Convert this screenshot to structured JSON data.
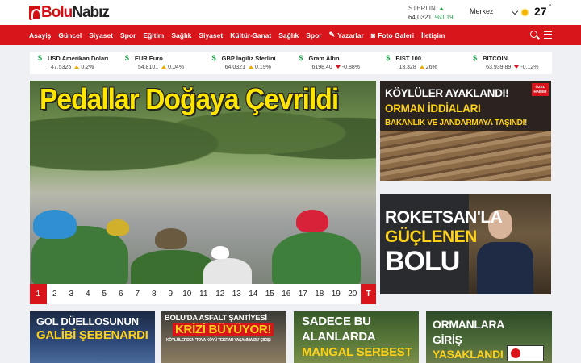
{
  "header": {
    "logo": {
      "part1": "Bolu",
      "part2": "Nabız"
    },
    "currency": {
      "label": "STERLIN",
      "value": "64,0321",
      "change": "%0.19"
    },
    "weather": {
      "city": "Merkez",
      "temperature": "27",
      "unit": "°",
      "icon": "sun-icon"
    }
  },
  "nav": {
    "items": [
      "Asayiş",
      "Güncel",
      "Siyaset",
      "Spor",
      "Eğitim",
      "Sağlık",
      "Siyaset",
      "Kültür-Sanat",
      "Sağlık",
      "Spor"
    ],
    "writers": "Yazarlar",
    "gallery": "Foto Galeri",
    "contact": "İletişim"
  },
  "ticker": [
    {
      "name": "USD Amerikan Doları",
      "value": "47,5325",
      "change": "0.2%",
      "direction": "up"
    },
    {
      "name": "EUR Euro",
      "value": "54,8101",
      "change": "0.04%",
      "direction": "up"
    },
    {
      "name": "GBP İngiliz Sterlini",
      "value": "64,0321",
      "change": "0.19%",
      "direction": "up"
    },
    {
      "name": "Gram Altın",
      "value": "6198.40",
      "change": "-0.88%",
      "direction": "down"
    },
    {
      "name": "BIST 100",
      "value": "13.328",
      "change": "26%",
      "direction": "up"
    },
    {
      "name": "BITCOIN",
      "value": "63.939,89",
      "change": "-0.12%",
      "direction": "down"
    }
  ],
  "hero": {
    "title": "Pedallar Doğaya Çevrildi"
  },
  "pager": {
    "pages": [
      "1",
      "2",
      "3",
      "4",
      "5",
      "6",
      "7",
      "8",
      "9",
      "10",
      "11",
      "12",
      "13",
      "14",
      "15",
      "16",
      "17",
      "18",
      "19",
      "20"
    ],
    "active": "1",
    "last": "T"
  },
  "side_cards": [
    {
      "line1": "KÖYLÜLER AYAKLANDI!",
      "line2": "ORMAN İDDİALARI",
      "line3": "BAKANLIK VE JANDARMAYA TAŞINDI!",
      "badge": "ÖZEL HABER"
    },
    {
      "line1": "ROKETSAN'LA",
      "line2": "GÜÇLENEN",
      "line3": "BOLU"
    }
  ],
  "bottom_cards": [
    {
      "line1": "GOL DÜELLOSUNUN",
      "line2": "GALİBİ ŞEBENARDI"
    },
    {
      "line1": "BOLU'DA ASFALT ŞANTİYESİ",
      "line2": "KRİZİ BÜYÜYOR!",
      "line3": "KÖYLÜLERDEN 'TOVA KÖYÜ TEKRAR YAŞANMASIN' ÇIKIŞI"
    },
    {
      "line1": "SADECE BU",
      "line2": "ALANLARDA",
      "line3": "MANGAL SERBEST"
    },
    {
      "line1": "ORMANLARA",
      "line2": "GİRİŞ",
      "line3": "YASAKLANDI"
    }
  ]
}
